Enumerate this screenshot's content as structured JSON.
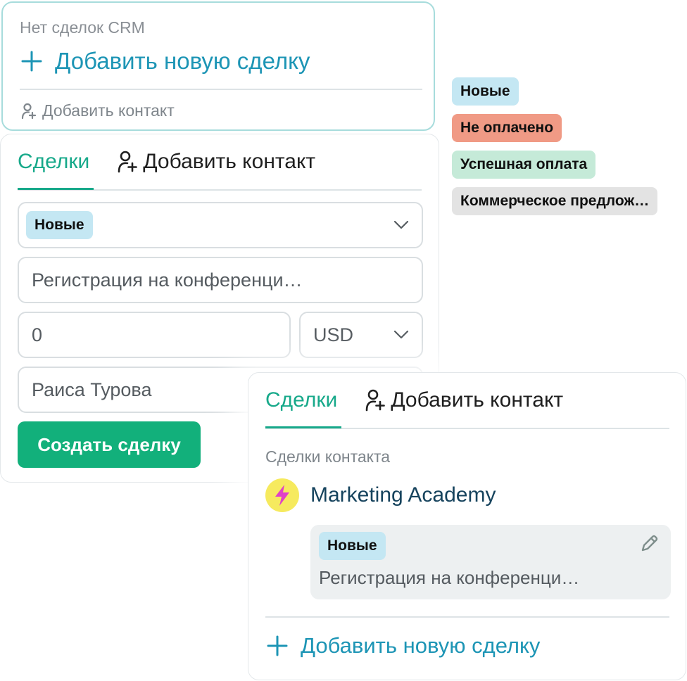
{
  "empty_crm": {
    "no_deals_text": "Нет сделок CRM",
    "add_deal_label": "Добавить новую сделку",
    "add_contact_label": "Добавить контакт"
  },
  "status_legend": [
    {
      "label": "Новые",
      "color": "#c4e7f3"
    },
    {
      "label": "Не оплачено",
      "color": "#f09a85"
    },
    {
      "label": "Успешная оплата",
      "color": "#c5ead8"
    },
    {
      "label": "Коммерческое предлож…",
      "color": "#e3e3e3"
    }
  ],
  "deal_form": {
    "tabs": {
      "deals": "Сделки",
      "add_contact": "Добавить контакт"
    },
    "status_selected": "Новые",
    "deal_name_value": "Регистрация на конференци…",
    "amount_value": "0",
    "currency_value": "USD",
    "contact_value": "Раиса Турова",
    "create_button": "Создать сделку"
  },
  "contact_deals": {
    "tabs": {
      "deals": "Сделки",
      "add_contact": "Добавить контакт"
    },
    "section_title": "Сделки контакта",
    "company_name": "Marketing Academy",
    "deal": {
      "status": "Новые",
      "name": "Регистрация на конференци…"
    },
    "add_deal_label": "Добавить новую сделку"
  },
  "colors": {
    "accent_green": "#12b07b",
    "tab_active": "#17a98a",
    "link_blue": "#1d95b5",
    "card_border_highlight": "#a7dcdc"
  }
}
